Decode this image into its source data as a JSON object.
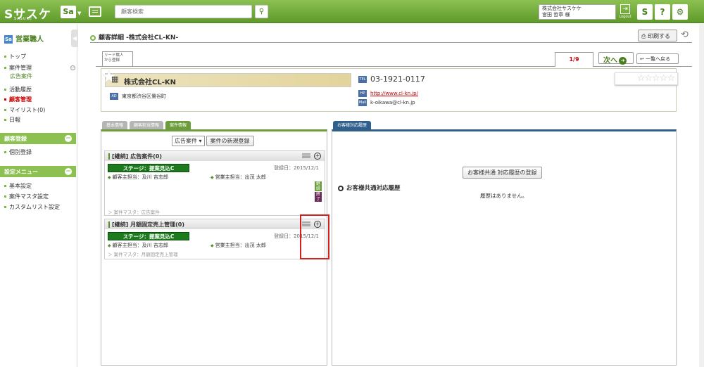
{
  "header": {
    "logo": "Sサスケ",
    "logo_sub": "SASUKE",
    "sa_label": "Sa",
    "search_placeholder": "顧客検索",
    "search_icon": "search-icon",
    "user_company": "株式会社サスケケ",
    "user_name": "宮田 哲章 様",
    "logout": "Logout",
    "s_label": "S",
    "help_label": "?",
    "gear_label": "⚙"
  },
  "sidebar": {
    "title": "営業職人",
    "title_icon": "Sa",
    "items_a": [
      {
        "label": "トップ"
      },
      {
        "label": "案件管理"
      },
      {
        "label": "広告案件"
      },
      {
        "label": "活動履歴"
      },
      {
        "label": "顧客管理"
      },
      {
        "label": "マイリスト(0)"
      },
      {
        "label": "日報"
      }
    ],
    "section_b": "顧客登録",
    "items_b": [
      {
        "label": "個別登録"
      }
    ],
    "section_c": "設定メニュー",
    "items_c": [
      {
        "label": "基本設定"
      },
      {
        "label": "案件マスタ設定"
      },
      {
        "label": "カスタムリスト設定"
      }
    ]
  },
  "page": {
    "title": "顧客詳細 -株式会社CL-KN-",
    "print_label": "印刷する",
    "lead_tab_line1": "リード職人",
    "lead_tab_line2": "から登録",
    "pager": "1/9",
    "next_label": "次へ",
    "back_label": "一覧へ戻る"
  },
  "customer": {
    "name": "株式会社CL-KN",
    "address": "東京都渋谷区鶯谷町",
    "address_icon": "AD",
    "tel": "03-1921-0117",
    "tel_icon": "TEL",
    "url": "http://www.cl-kn.jp/",
    "url_icon": "HP",
    "mail": "k-oikawa@cl-kn.jp",
    "mail_icon": "Mail",
    "rating": "☆☆☆☆☆"
  },
  "tabs": {
    "basic": "基本情報",
    "owner": "顧客担当情報",
    "case": "案件情報",
    "right": "お客様対応履歴"
  },
  "filter": {
    "select_value": "広告案件",
    "new_button": "案件の新規登録"
  },
  "cases": [
    {
      "title": "[継続] 広告案件(0)",
      "stage": "ステージ：提案見込C",
      "date": "登録日：2015/12/1",
      "customer_owner": "顧客主担当：及川 吉志郎",
      "sales_owner": "営業主担当：出茂 太郎",
      "master": "案件マスタ：広告案件",
      "side1": "継続",
      "side2": "終了"
    },
    {
      "title": "[継続] 月額固定売上管理(0)",
      "stage": "ステージ：提案見込C",
      "date": "登録日：2015/12/1",
      "customer_owner": "顧客主担当：及川 吉志郎",
      "sales_owner": "営業主担当：出茂 太郎",
      "master": "案件マスタ：月額固定売上管理"
    }
  ],
  "right_panel": {
    "register_button": "お客様共通 対応履歴の登録",
    "history_title": "お客様共通対応履歴",
    "empty_text": "履歴はありません。"
  }
}
